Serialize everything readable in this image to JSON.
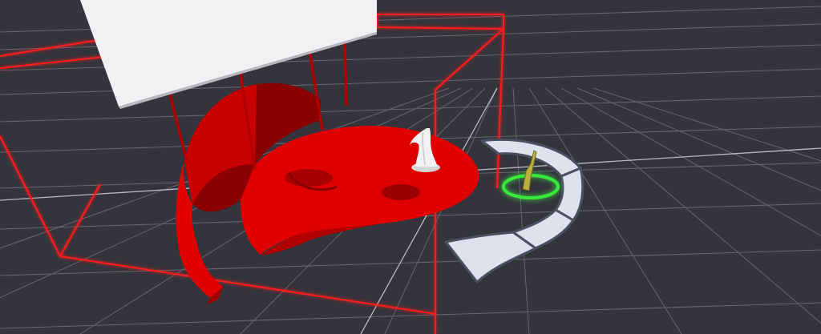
{
  "viewport": {
    "background_color": "#34343c",
    "grid_color": "#6f6f78",
    "grid_highlight_color": "#c8c8d2"
  },
  "scene": {
    "danger_zone_color": "#e00000",
    "danger_zone_glow_color": "#ff1a1a",
    "panel_color": "#f1f1f4",
    "walkway_color": "#dfe1ec",
    "walkway_border_color": "#4a5060",
    "selection_ring_color": "#39e83a",
    "handle_color": "#b8b040",
    "figure_color": "#f2f2f2"
  }
}
